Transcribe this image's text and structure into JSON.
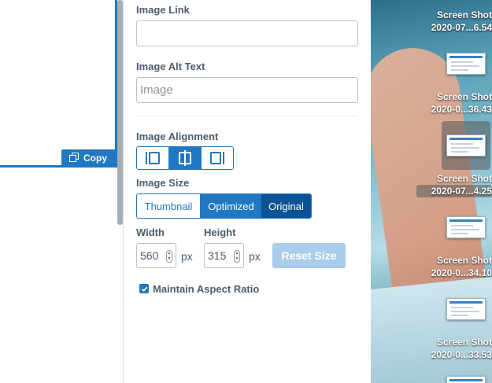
{
  "editor": {
    "copy_label": "Copy"
  },
  "panel": {
    "image_link": {
      "label": "Image Link",
      "value": ""
    },
    "alt_text": {
      "label": "Image Alt Text",
      "value": "Image"
    },
    "alignment": {
      "label": "Image Alignment",
      "options": [
        "align-left",
        "align-center",
        "align-right"
      ],
      "selected": "align-center"
    },
    "size": {
      "label": "Image Size",
      "options": [
        "Thumbnail",
        "Optimized",
        "Original"
      ],
      "selected": "Original"
    },
    "width": {
      "label": "Width",
      "value": "560",
      "unit": "px"
    },
    "height": {
      "label": "Height",
      "value": "315",
      "unit": "px"
    },
    "reset_label": "Reset Size",
    "aspect_ratio": {
      "label": "Maintain Aspect Ratio",
      "checked": true
    }
  },
  "desktop": {
    "files": [
      {
        "name": "Screen Shot",
        "date": "2020-07...6.54"
      },
      {
        "name": "Screen Shot",
        "date": "2020-0...36.43"
      },
      {
        "name": "Screen Shot",
        "date": "2020-07...4.25",
        "selected": true
      },
      {
        "name": "Screen Shot",
        "date": "2020-0...34.10"
      },
      {
        "name": "Screen Shot",
        "date": "2020-0...33.53"
      }
    ]
  },
  "colors": {
    "accent": "#1f78c1",
    "accent_dark": "#0b5394",
    "reset_disabled": "#a9cdeb",
    "label_text": "#4c5b6b"
  }
}
